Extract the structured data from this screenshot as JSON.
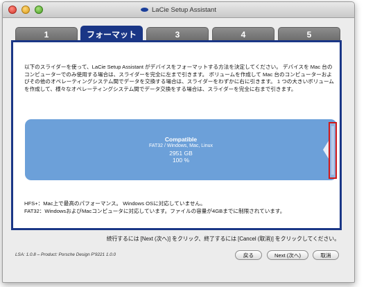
{
  "window": {
    "title": "LaCie Setup Assistant"
  },
  "tabs": [
    {
      "label": "1"
    },
    {
      "label": "フォーマット"
    },
    {
      "label": "3"
    },
    {
      "label": "4"
    },
    {
      "label": "5"
    }
  ],
  "description": "以下のスライダーを使って、LaCie Setup Assistant がデバイスをフォーマットする方法を決定してください。 デバイスを Mac 台のコンピューターでのみ使用する場合は、スライダーを完全に左まで引きます。 ボリュームを作成して Mac 台のコンピューターおよびその他のオペレーティングシステム間でデータを交換する場合は、スライダーをわずかに右に引きます。 1 つの大きいボリュームを作成して、様々なオペレーティングシステム間でデータ交換をする場合は、スライダーを完全に右まで引きます。",
  "partition": {
    "name": "Compatible",
    "format": "FAT32 / Windows, Mac, Linux",
    "size": "2951 GB",
    "percent": "100 %"
  },
  "slider": {
    "level": 1.0
  },
  "notes": {
    "hfs": "HFS+：Mac上で最高のパフォーマンス。 Windows OSに対応していません。",
    "fat32": "FAT32：WindowsおよびMacコンピュータに対応しています。ファイルの容量が4GBまでに制限されています。"
  },
  "instruction": "続行するには [Next (次へ)] をクリック、終了するには [Cancel (取消)] をクリックしてください。",
  "version": "LSA: 1.0.8 – Product: Porsche Design P'9221 1.0.0",
  "buttons": {
    "back": "戻る",
    "next": "Next (次へ)",
    "cancel": "取消"
  },
  "colors": {
    "accent": "#1a3686",
    "partition_fill": "#6ca0d9",
    "slider_highlight": "#d01818"
  },
  "icons": {
    "logo": "lacie-logo-icon"
  }
}
